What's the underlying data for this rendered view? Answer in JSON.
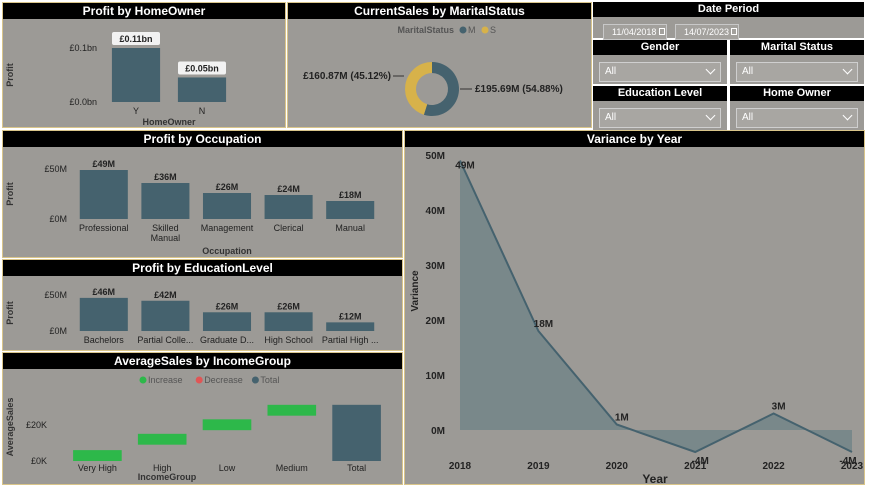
{
  "panels": {
    "homeowner_title": "Profit by HomeOwner",
    "marital_title": "CurrentSales by MaritalStatus",
    "occupation_title": "Profit by Occupation",
    "education_title": "Profit by EducationLevel",
    "income_title": "AverageSales by IncomeGroup",
    "variance_title": "Variance by Year"
  },
  "slicers": {
    "date_period": {
      "title": "Date Period",
      "start": "11/04/2018",
      "end": "14/07/2023"
    },
    "gender": {
      "title": "Gender",
      "value": "All"
    },
    "marital_status": {
      "title": "Marital Status",
      "value": "All"
    },
    "education_level": {
      "title": "Education Level",
      "value": "All"
    },
    "home_owner": {
      "title": "Home Owner",
      "value": "All"
    }
  },
  "colors": {
    "bar": "#45626e",
    "line": "#45626e",
    "donut_s": "#d7b24a",
    "increase": "#2db84a",
    "decrease": "#e05656",
    "total": "#45626e"
  },
  "chart_data": [
    {
      "id": "homeowner",
      "type": "bar",
      "title": "Profit by HomeOwner",
      "categories": [
        "Y",
        "N"
      ],
      "values": [
        0.11,
        0.05
      ],
      "labels": [
        "£0.11bn",
        "£0.05bn"
      ],
      "ylabel": "Profit",
      "xlabel": "HomeOwner",
      "yticks": [
        "£0.0bn",
        "£0.1bn"
      ],
      "ylim": [
        0,
        0.11
      ]
    },
    {
      "id": "marital",
      "type": "pie",
      "title": "CurrentSales by MaritalStatus",
      "legend_title": "MaritalStatus",
      "legend": [
        "M",
        "S"
      ],
      "slices": [
        {
          "name": "M",
          "value": 195.69,
          "label": "£195.69M (54.88%)"
        },
        {
          "name": "S",
          "value": 160.87,
          "label": "£160.87M (45.12%)"
        }
      ]
    },
    {
      "id": "occupation",
      "type": "bar",
      "title": "Profit by Occupation",
      "categories": [
        "Professional",
        "Skilled Manual",
        "Management",
        "Clerical",
        "Manual"
      ],
      "values": [
        49,
        36,
        26,
        24,
        18
      ],
      "labels": [
        "£49M",
        "£36M",
        "£26M",
        "£24M",
        "£18M"
      ],
      "ylabel": "Profit",
      "xlabel": "Occupation",
      "yticks": [
        "£0M",
        "£50M"
      ],
      "ylim": [
        0,
        50
      ]
    },
    {
      "id": "education",
      "type": "bar",
      "title": "Profit by EducationLevel",
      "categories": [
        "Bachelors",
        "Partial Colle...",
        "Graduate D...",
        "High School",
        "Partial High ..."
      ],
      "values": [
        46,
        42,
        26,
        26,
        12
      ],
      "labels": [
        "£46M",
        "£42M",
        "£26M",
        "£26M",
        "£12M"
      ],
      "ylabel": "Profit",
      "xlabel": "",
      "yticks": [
        "£0M",
        "£50M"
      ],
      "ylim": [
        0,
        50
      ]
    },
    {
      "id": "income",
      "type": "bar",
      "subtype": "waterfall",
      "title": "AverageSales by IncomeGroup",
      "legend": [
        "Increase",
        "Decrease",
        "Total"
      ],
      "categories": [
        "Very High",
        "High",
        "Low",
        "Medium",
        "Total"
      ],
      "steps": [
        {
          "start": 0,
          "end": 6,
          "kind": "increase"
        },
        {
          "start": 9,
          "end": 15,
          "kind": "increase"
        },
        {
          "start": 17,
          "end": 23,
          "kind": "increase"
        },
        {
          "start": 25,
          "end": 31,
          "kind": "increase"
        },
        {
          "start": 0,
          "end": 31,
          "kind": "total"
        }
      ],
      "ylabel": "AverageSales",
      "xlabel": "IncomeGroup",
      "yticks": [
        "£0K",
        "£20K"
      ],
      "ylim": [
        0,
        32
      ]
    },
    {
      "id": "variance",
      "type": "area",
      "title": "Variance by Year",
      "x": [
        "2018",
        "2019",
        "2020",
        "2021",
        "2022",
        "2023"
      ],
      "values": [
        49,
        18,
        1,
        -4,
        3,
        -4
      ],
      "labels": [
        "49M",
        "18M",
        "1M",
        "-4M",
        "3M",
        "-4M"
      ],
      "ylabel": "Variance",
      "xlabel": "Year",
      "yticks": [
        "0M",
        "10M",
        "20M",
        "30M",
        "40M",
        "50M"
      ],
      "ylim": [
        -4,
        50
      ]
    }
  ]
}
